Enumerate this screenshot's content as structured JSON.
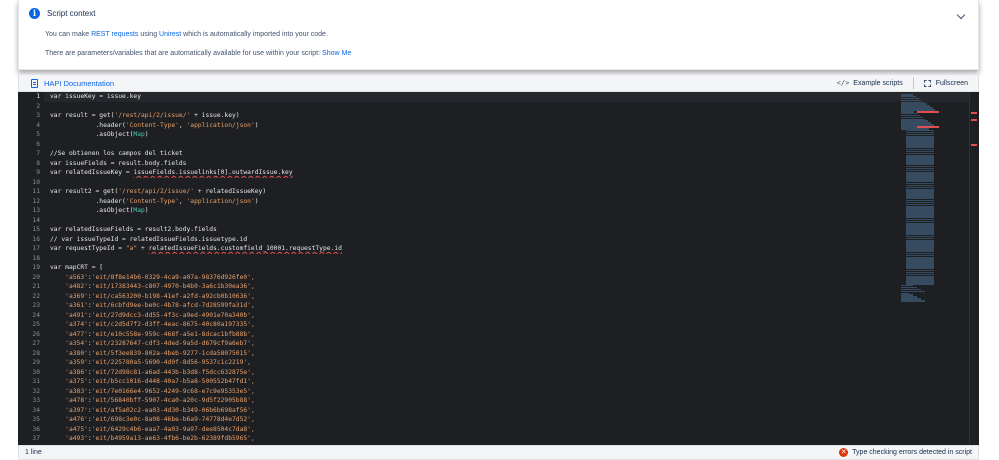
{
  "context": {
    "title": "Script context",
    "line1_pre": "You can make ",
    "line1_link1": "REST requests",
    "line1_mid": " using ",
    "line1_link2": "Unirest",
    "line1_post": " which is automatically imported into your code.",
    "line2_pre": "There are parameters/variables that are automatically available for use within your script: ",
    "line2_link": "Show Me"
  },
  "toolbar": {
    "doc_label": "HAPI Documentation",
    "example_label": "Example scripts",
    "fullscreen_label": "Fullscreen"
  },
  "editor": {
    "line_numbers": [
      "1",
      "2",
      "3",
      "4",
      "5",
      "6",
      "7",
      "8",
      "9",
      "10",
      "11",
      "12",
      "13",
      "14",
      "15",
      "16",
      "17",
      "18",
      "19",
      "20",
      "21",
      "22",
      "23",
      "24",
      "25",
      "26",
      "27",
      "28",
      "29",
      "30",
      "31",
      "32",
      "33",
      "34",
      "35",
      "36",
      "37"
    ],
    "code": {
      "l1": "var issueKey = issue.key",
      "l3a": "var result = get(",
      "l3s": "'/rest/api/2/issue/'",
      "l3b": " + issue.key)",
      "l4a": "            .header(",
      "l4s1": "'Content-Type'",
      "l4c": ", ",
      "l4s2": "'application/json'",
      "l4b": ")",
      "l5a": "            .asObject(",
      "l5t": "Map",
      "l5b": ")",
      "l7": "//Se obtienen los campos del ticket",
      "l8": "var issueFields = result.body.fields",
      "l9a": "var relatedIssueKey = ",
      "l9e": "issueFields.issuelinks[0].outwardIssue.key",
      "l11a": "var result2 = get(",
      "l11s": "'/rest/api/2/issue/'",
      "l11b": " + relatedIssueKey)",
      "l12a": "            .header(",
      "l12s1": "'Content-Type'",
      "l12c": ", ",
      "l12s2": "'application/json'",
      "l12b": ")",
      "l13a": "            .asObject(",
      "l13t": "Map",
      "l13b": ")",
      "l15": "var relatedIssueFields = result2.body.fields",
      "l16": "// var issueTypeId = relatedIssueFields.issuetype.id",
      "l17a": "var requestTypeId = ",
      "l17s": "\"a\"",
      "l17b": " + ",
      "l17e": "relatedIssueFields.customfield_10001.requestType.id",
      "l19": "var mapCRT = ["
    },
    "map_entries": [
      {
        "key": "'a563'",
        "val": "'eit/8f8e14b6-0329-4ca9-a07a-98376d926fe0',"
      },
      {
        "key": "'a482'",
        "val": "'eit/17383443-c807-4970-b4b0-3a6c1b30ea36',"
      },
      {
        "key": "'a369'",
        "val": "'eit/ca563200-b198-41ef-a2fd-a92cb0b10636',"
      },
      {
        "key": "'a361'",
        "val": "'eit/6cbfd9ee-be0c-4b78-afcd-7d28599fa31d',"
      },
      {
        "key": "'a491'",
        "val": "'eit/27d9dcc3-dd55-4f3c-a9ed-4901e70a340b',"
      },
      {
        "key": "'a374'",
        "val": "'eit/c2d5d7f2-d3ff-4eac-8675-40c80a197335',"
      },
      {
        "key": "'a477'",
        "val": "'eit/e10c558e-959c-468f-a5e1-8dcac1bfb88b',"
      },
      {
        "key": "'a354'",
        "val": "'eit/23287647-cdf3-4ded-9a5d-d679cf9a6eb7',"
      },
      {
        "key": "'a380'",
        "val": "'eit/5f3ee839-802a-4beb-9277-1cda58075015',"
      },
      {
        "key": "'a359'",
        "val": "'eit/225780a5-5690-4d0f-8d56-9537c1c2219',"
      },
      {
        "key": "'a386'",
        "val": "'eit/72d98c81-a6ad-443b-b3d8-f5dcc632875e',"
      },
      {
        "key": "'a375'",
        "val": "'eit/b5cc1016-d448-40a7-b5a8-500552b47fd1',"
      },
      {
        "key": "'a383'",
        "val": "'eit/7e0166e4-9652-4249-9c68-e7c9e95353e5',"
      },
      {
        "key": "'a478'",
        "val": "'eit/56840bff-5907-4ca0-a20c-9d5f22905b88',"
      },
      {
        "key": "'a397'",
        "val": "'eit/af5a02c2-ea03-4d30-b349-06b6b698af56',"
      },
      {
        "key": "'a476'",
        "val": "'eit/698c3e0c-8a08-46be-b6a9-74778d4e7d52',"
      },
      {
        "key": "'a475'",
        "val": "'eit/6429c4b6-eaa7-4a03-9a97-dee8504c7da8',"
      },
      {
        "key": "'a493'",
        "val": "'eit/b4959a13-ae63-4fb6-be2b-62389fdb5965',"
      }
    ]
  },
  "status": {
    "lines": "1 line",
    "error_text": "Type checking errors detected in script"
  },
  "colors": {
    "accent": "#0c66e4",
    "editor_bg": "#1e1f23",
    "string": "#e6a06a",
    "comment": "#6a9955",
    "error": "#de350b"
  }
}
